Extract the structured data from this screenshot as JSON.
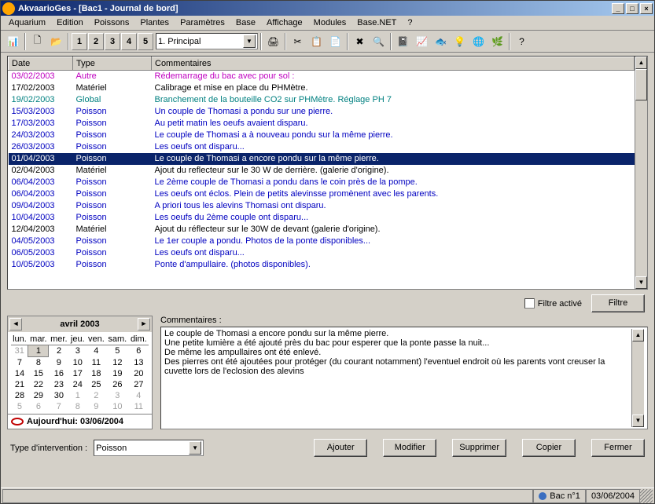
{
  "title": "AkvaarioGes - [Bac1  -  Journal de bord]",
  "menu": [
    "Aquarium",
    "Edition",
    "Poissons",
    "Plantes",
    "Paramètres",
    "Base",
    "Affichage",
    "Modules",
    "Base.NET",
    "?"
  ],
  "toolbar": {
    "numbers": [
      "1",
      "2",
      "3",
      "4",
      "5"
    ],
    "combo": "1. Principal"
  },
  "grid": {
    "headers": [
      "Date",
      "Type",
      "Commentaires"
    ],
    "rows": [
      {
        "date": "03/02/2003",
        "type": "Autre",
        "comment": "Rédemarrage du bac avec pour sol :",
        "cls": "c-magenta"
      },
      {
        "date": "17/02/2003",
        "type": "Matériel",
        "comment": "Calibrage et mise en place du PHMètre.",
        "cls": ""
      },
      {
        "date": "19/02/2003",
        "type": "Global",
        "comment": "Branchement de la bouteille CO2 sur PHMètre. Réglage PH 7",
        "cls": "c-teal"
      },
      {
        "date": "15/03/2003",
        "type": "Poisson",
        "comment": "Un couple de Thomasi a pondu sur une pierre.",
        "cls": "c-blue"
      },
      {
        "date": "17/03/2003",
        "type": "Poisson",
        "comment": "Au petit matin les oeufs avaient disparu.",
        "cls": "c-blue"
      },
      {
        "date": "24/03/2003",
        "type": "Poisson",
        "comment": "Le couple de Thomasi a à nouveau pondu sur la même pierre.",
        "cls": "c-blue"
      },
      {
        "date": "26/03/2003",
        "type": "Poisson",
        "comment": "Les oeufs ont disparu...",
        "cls": "c-blue"
      },
      {
        "date": "01/04/2003",
        "type": "Poisson",
        "comment": "Le couple de Thomasi a encore pondu sur la même pierre.",
        "cls": "c-blue",
        "sel": true
      },
      {
        "date": "02/04/2003",
        "type": "Matériel",
        "comment": "Ajout du reflecteur sur le 30 W de derrière. (galerie d'origine).",
        "cls": ""
      },
      {
        "date": "06/04/2003",
        "type": "Poisson",
        "comment": "Le 2ème couple de Thomasi a pondu dans le coin près de la pompe.",
        "cls": "c-blue"
      },
      {
        "date": "06/04/2003",
        "type": "Poisson",
        "comment": "Les oeufs ont éclos. Plein de petits alevinsse promènent avec les parents.",
        "cls": "c-blue"
      },
      {
        "date": "09/04/2003",
        "type": "Poisson",
        "comment": "A priori tous les alevins Thomasi ont disparu.",
        "cls": "c-blue"
      },
      {
        "date": "10/04/2003",
        "type": "Poisson",
        "comment": "Les oeufs du 2ème couple ont disparu...",
        "cls": "c-blue"
      },
      {
        "date": "12/04/2003",
        "type": "Matériel",
        "comment": "Ajout du réflecteur sur le 30W de devant (galerie d'origine).",
        "cls": ""
      },
      {
        "date": "04/05/2003",
        "type": "Poisson",
        "comment": "Le 1er couple a pondu. Photos de la ponte disponibles...",
        "cls": "c-blue"
      },
      {
        "date": "06/05/2003",
        "type": "Poisson",
        "comment": "Les oeufs ont disparu...",
        "cls": "c-blue"
      },
      {
        "date": "10/05/2003",
        "type": "Poisson",
        "comment": "Ponte d'ampullaire. (photos disponibles).",
        "cls": "c-blue"
      }
    ]
  },
  "filter": {
    "checkbox": "Filtre activé",
    "button": "Filtre"
  },
  "calendar": {
    "title": "avril 2003",
    "dow": [
      "lun.",
      "mar.",
      "mer.",
      "jeu.",
      "ven.",
      "sam.",
      "dim."
    ],
    "weeks": [
      [
        {
          "d": "31",
          "g": 1
        },
        {
          "d": "1",
          "today": 1
        },
        {
          "d": "2"
        },
        {
          "d": "3"
        },
        {
          "d": "4"
        },
        {
          "d": "5"
        },
        {
          "d": "6"
        }
      ],
      [
        {
          "d": "7"
        },
        {
          "d": "8"
        },
        {
          "d": "9"
        },
        {
          "d": "10"
        },
        {
          "d": "11"
        },
        {
          "d": "12"
        },
        {
          "d": "13"
        }
      ],
      [
        {
          "d": "14"
        },
        {
          "d": "15"
        },
        {
          "d": "16"
        },
        {
          "d": "17"
        },
        {
          "d": "18"
        },
        {
          "d": "19"
        },
        {
          "d": "20"
        }
      ],
      [
        {
          "d": "21"
        },
        {
          "d": "22"
        },
        {
          "d": "23"
        },
        {
          "d": "24"
        },
        {
          "d": "25"
        },
        {
          "d": "26"
        },
        {
          "d": "27"
        }
      ],
      [
        {
          "d": "28"
        },
        {
          "d": "29"
        },
        {
          "d": "30"
        },
        {
          "d": "1",
          "g": 1
        },
        {
          "d": "2",
          "g": 1
        },
        {
          "d": "3",
          "g": 1
        },
        {
          "d": "4",
          "g": 1
        }
      ],
      [
        {
          "d": "5",
          "g": 1
        },
        {
          "d": "6",
          "g": 1
        },
        {
          "d": "7",
          "g": 1
        },
        {
          "d": "8",
          "g": 1
        },
        {
          "d": "9",
          "g": 1
        },
        {
          "d": "10",
          "g": 1
        },
        {
          "d": "11",
          "g": 1
        }
      ]
    ],
    "today_label": "Aujourd'hui:  03/06/2004"
  },
  "comments": {
    "label": "Commentaires :",
    "text": "Le couple de Thomasi a encore pondu sur la même pierre.\nUne petite lumière a été ajouté près du bac pour esperer que la ponte passe la nuit...\nDe même les ampullaires ont été enlevé.\nDes pierres ont été ajoutées pour protéger (du courant notamment) l'eventuel endroit où les parents vont creuser la cuvette lors de l'eclosion des alevins"
  },
  "bottom": {
    "type_label": "Type d'intervention :",
    "type_value": "Poisson",
    "buttons": [
      "Ajouter",
      "Modifier",
      "Supprimer",
      "Copier",
      "Fermer"
    ]
  },
  "status": {
    "bac": "Bac n°1",
    "date": "03/06/2004"
  }
}
